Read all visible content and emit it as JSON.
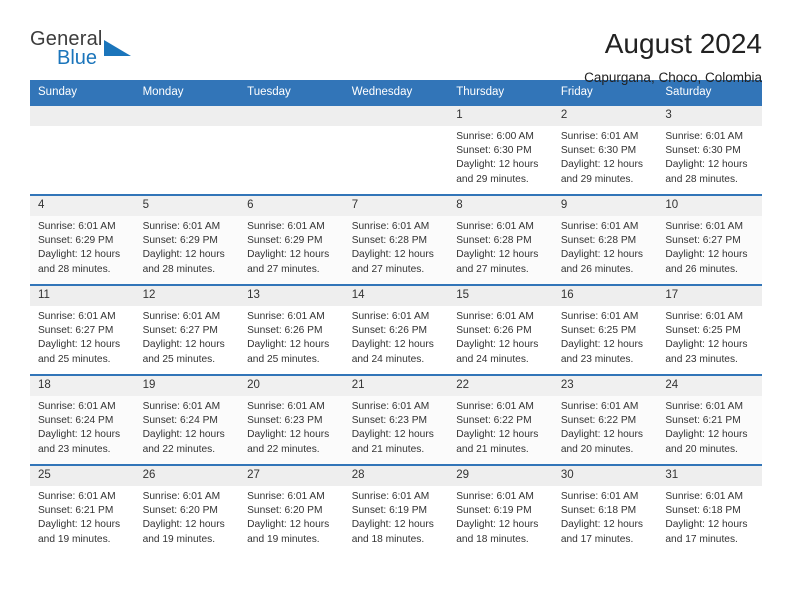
{
  "brand": {
    "name_part1": "General",
    "name_part2": "Blue",
    "logo_icon": "triangle-icon"
  },
  "header": {
    "title": "August 2024",
    "location": "Capurgana, Choco, Colombia"
  },
  "calendar": {
    "weekdays": [
      "Sunday",
      "Monday",
      "Tuesday",
      "Wednesday",
      "Thursday",
      "Friday",
      "Saturday"
    ],
    "accent_color": "#3275b8",
    "daynum_band_color": "#eeeeee",
    "weeks": [
      [
        {
          "day": "",
          "sunrise": "",
          "sunset": "",
          "daylight_line1": "",
          "daylight_line2": ""
        },
        {
          "day": "",
          "sunrise": "",
          "sunset": "",
          "daylight_line1": "",
          "daylight_line2": ""
        },
        {
          "day": "",
          "sunrise": "",
          "sunset": "",
          "daylight_line1": "",
          "daylight_line2": ""
        },
        {
          "day": "",
          "sunrise": "",
          "sunset": "",
          "daylight_line1": "",
          "daylight_line2": ""
        },
        {
          "day": "1",
          "sunrise": "Sunrise: 6:00 AM",
          "sunset": "Sunset: 6:30 PM",
          "daylight_line1": "Daylight: 12 hours",
          "daylight_line2": "and 29 minutes."
        },
        {
          "day": "2",
          "sunrise": "Sunrise: 6:01 AM",
          "sunset": "Sunset: 6:30 PM",
          "daylight_line1": "Daylight: 12 hours",
          "daylight_line2": "and 29 minutes."
        },
        {
          "day": "3",
          "sunrise": "Sunrise: 6:01 AM",
          "sunset": "Sunset: 6:30 PM",
          "daylight_line1": "Daylight: 12 hours",
          "daylight_line2": "and 28 minutes."
        }
      ],
      [
        {
          "day": "4",
          "sunrise": "Sunrise: 6:01 AM",
          "sunset": "Sunset: 6:29 PM",
          "daylight_line1": "Daylight: 12 hours",
          "daylight_line2": "and 28 minutes."
        },
        {
          "day": "5",
          "sunrise": "Sunrise: 6:01 AM",
          "sunset": "Sunset: 6:29 PM",
          "daylight_line1": "Daylight: 12 hours",
          "daylight_line2": "and 28 minutes."
        },
        {
          "day": "6",
          "sunrise": "Sunrise: 6:01 AM",
          "sunset": "Sunset: 6:29 PM",
          "daylight_line1": "Daylight: 12 hours",
          "daylight_line2": "and 27 minutes."
        },
        {
          "day": "7",
          "sunrise": "Sunrise: 6:01 AM",
          "sunset": "Sunset: 6:28 PM",
          "daylight_line1": "Daylight: 12 hours",
          "daylight_line2": "and 27 minutes."
        },
        {
          "day": "8",
          "sunrise": "Sunrise: 6:01 AM",
          "sunset": "Sunset: 6:28 PM",
          "daylight_line1": "Daylight: 12 hours",
          "daylight_line2": "and 27 minutes."
        },
        {
          "day": "9",
          "sunrise": "Sunrise: 6:01 AM",
          "sunset": "Sunset: 6:28 PM",
          "daylight_line1": "Daylight: 12 hours",
          "daylight_line2": "and 26 minutes."
        },
        {
          "day": "10",
          "sunrise": "Sunrise: 6:01 AM",
          "sunset": "Sunset: 6:27 PM",
          "daylight_line1": "Daylight: 12 hours",
          "daylight_line2": "and 26 minutes."
        }
      ],
      [
        {
          "day": "11",
          "sunrise": "Sunrise: 6:01 AM",
          "sunset": "Sunset: 6:27 PM",
          "daylight_line1": "Daylight: 12 hours",
          "daylight_line2": "and 25 minutes."
        },
        {
          "day": "12",
          "sunrise": "Sunrise: 6:01 AM",
          "sunset": "Sunset: 6:27 PM",
          "daylight_line1": "Daylight: 12 hours",
          "daylight_line2": "and 25 minutes."
        },
        {
          "day": "13",
          "sunrise": "Sunrise: 6:01 AM",
          "sunset": "Sunset: 6:26 PM",
          "daylight_line1": "Daylight: 12 hours",
          "daylight_line2": "and 25 minutes."
        },
        {
          "day": "14",
          "sunrise": "Sunrise: 6:01 AM",
          "sunset": "Sunset: 6:26 PM",
          "daylight_line1": "Daylight: 12 hours",
          "daylight_line2": "and 24 minutes."
        },
        {
          "day": "15",
          "sunrise": "Sunrise: 6:01 AM",
          "sunset": "Sunset: 6:26 PM",
          "daylight_line1": "Daylight: 12 hours",
          "daylight_line2": "and 24 minutes."
        },
        {
          "day": "16",
          "sunrise": "Sunrise: 6:01 AM",
          "sunset": "Sunset: 6:25 PM",
          "daylight_line1": "Daylight: 12 hours",
          "daylight_line2": "and 23 minutes."
        },
        {
          "day": "17",
          "sunrise": "Sunrise: 6:01 AM",
          "sunset": "Sunset: 6:25 PM",
          "daylight_line1": "Daylight: 12 hours",
          "daylight_line2": "and 23 minutes."
        }
      ],
      [
        {
          "day": "18",
          "sunrise": "Sunrise: 6:01 AM",
          "sunset": "Sunset: 6:24 PM",
          "daylight_line1": "Daylight: 12 hours",
          "daylight_line2": "and 23 minutes."
        },
        {
          "day": "19",
          "sunrise": "Sunrise: 6:01 AM",
          "sunset": "Sunset: 6:24 PM",
          "daylight_line1": "Daylight: 12 hours",
          "daylight_line2": "and 22 minutes."
        },
        {
          "day": "20",
          "sunrise": "Sunrise: 6:01 AM",
          "sunset": "Sunset: 6:23 PM",
          "daylight_line1": "Daylight: 12 hours",
          "daylight_line2": "and 22 minutes."
        },
        {
          "day": "21",
          "sunrise": "Sunrise: 6:01 AM",
          "sunset": "Sunset: 6:23 PM",
          "daylight_line1": "Daylight: 12 hours",
          "daylight_line2": "and 21 minutes."
        },
        {
          "day": "22",
          "sunrise": "Sunrise: 6:01 AM",
          "sunset": "Sunset: 6:22 PM",
          "daylight_line1": "Daylight: 12 hours",
          "daylight_line2": "and 21 minutes."
        },
        {
          "day": "23",
          "sunrise": "Sunrise: 6:01 AM",
          "sunset": "Sunset: 6:22 PM",
          "daylight_line1": "Daylight: 12 hours",
          "daylight_line2": "and 20 minutes."
        },
        {
          "day": "24",
          "sunrise": "Sunrise: 6:01 AM",
          "sunset": "Sunset: 6:21 PM",
          "daylight_line1": "Daylight: 12 hours",
          "daylight_line2": "and 20 minutes."
        }
      ],
      [
        {
          "day": "25",
          "sunrise": "Sunrise: 6:01 AM",
          "sunset": "Sunset: 6:21 PM",
          "daylight_line1": "Daylight: 12 hours",
          "daylight_line2": "and 19 minutes."
        },
        {
          "day": "26",
          "sunrise": "Sunrise: 6:01 AM",
          "sunset": "Sunset: 6:20 PM",
          "daylight_line1": "Daylight: 12 hours",
          "daylight_line2": "and 19 minutes."
        },
        {
          "day": "27",
          "sunrise": "Sunrise: 6:01 AM",
          "sunset": "Sunset: 6:20 PM",
          "daylight_line1": "Daylight: 12 hours",
          "daylight_line2": "and 19 minutes."
        },
        {
          "day": "28",
          "sunrise": "Sunrise: 6:01 AM",
          "sunset": "Sunset: 6:19 PM",
          "daylight_line1": "Daylight: 12 hours",
          "daylight_line2": "and 18 minutes."
        },
        {
          "day": "29",
          "sunrise": "Sunrise: 6:01 AM",
          "sunset": "Sunset: 6:19 PM",
          "daylight_line1": "Daylight: 12 hours",
          "daylight_line2": "and 18 minutes."
        },
        {
          "day": "30",
          "sunrise": "Sunrise: 6:01 AM",
          "sunset": "Sunset: 6:18 PM",
          "daylight_line1": "Daylight: 12 hours",
          "daylight_line2": "and 17 minutes."
        },
        {
          "day": "31",
          "sunrise": "Sunrise: 6:01 AM",
          "sunset": "Sunset: 6:18 PM",
          "daylight_line1": "Daylight: 12 hours",
          "daylight_line2": "and 17 minutes."
        }
      ]
    ]
  }
}
